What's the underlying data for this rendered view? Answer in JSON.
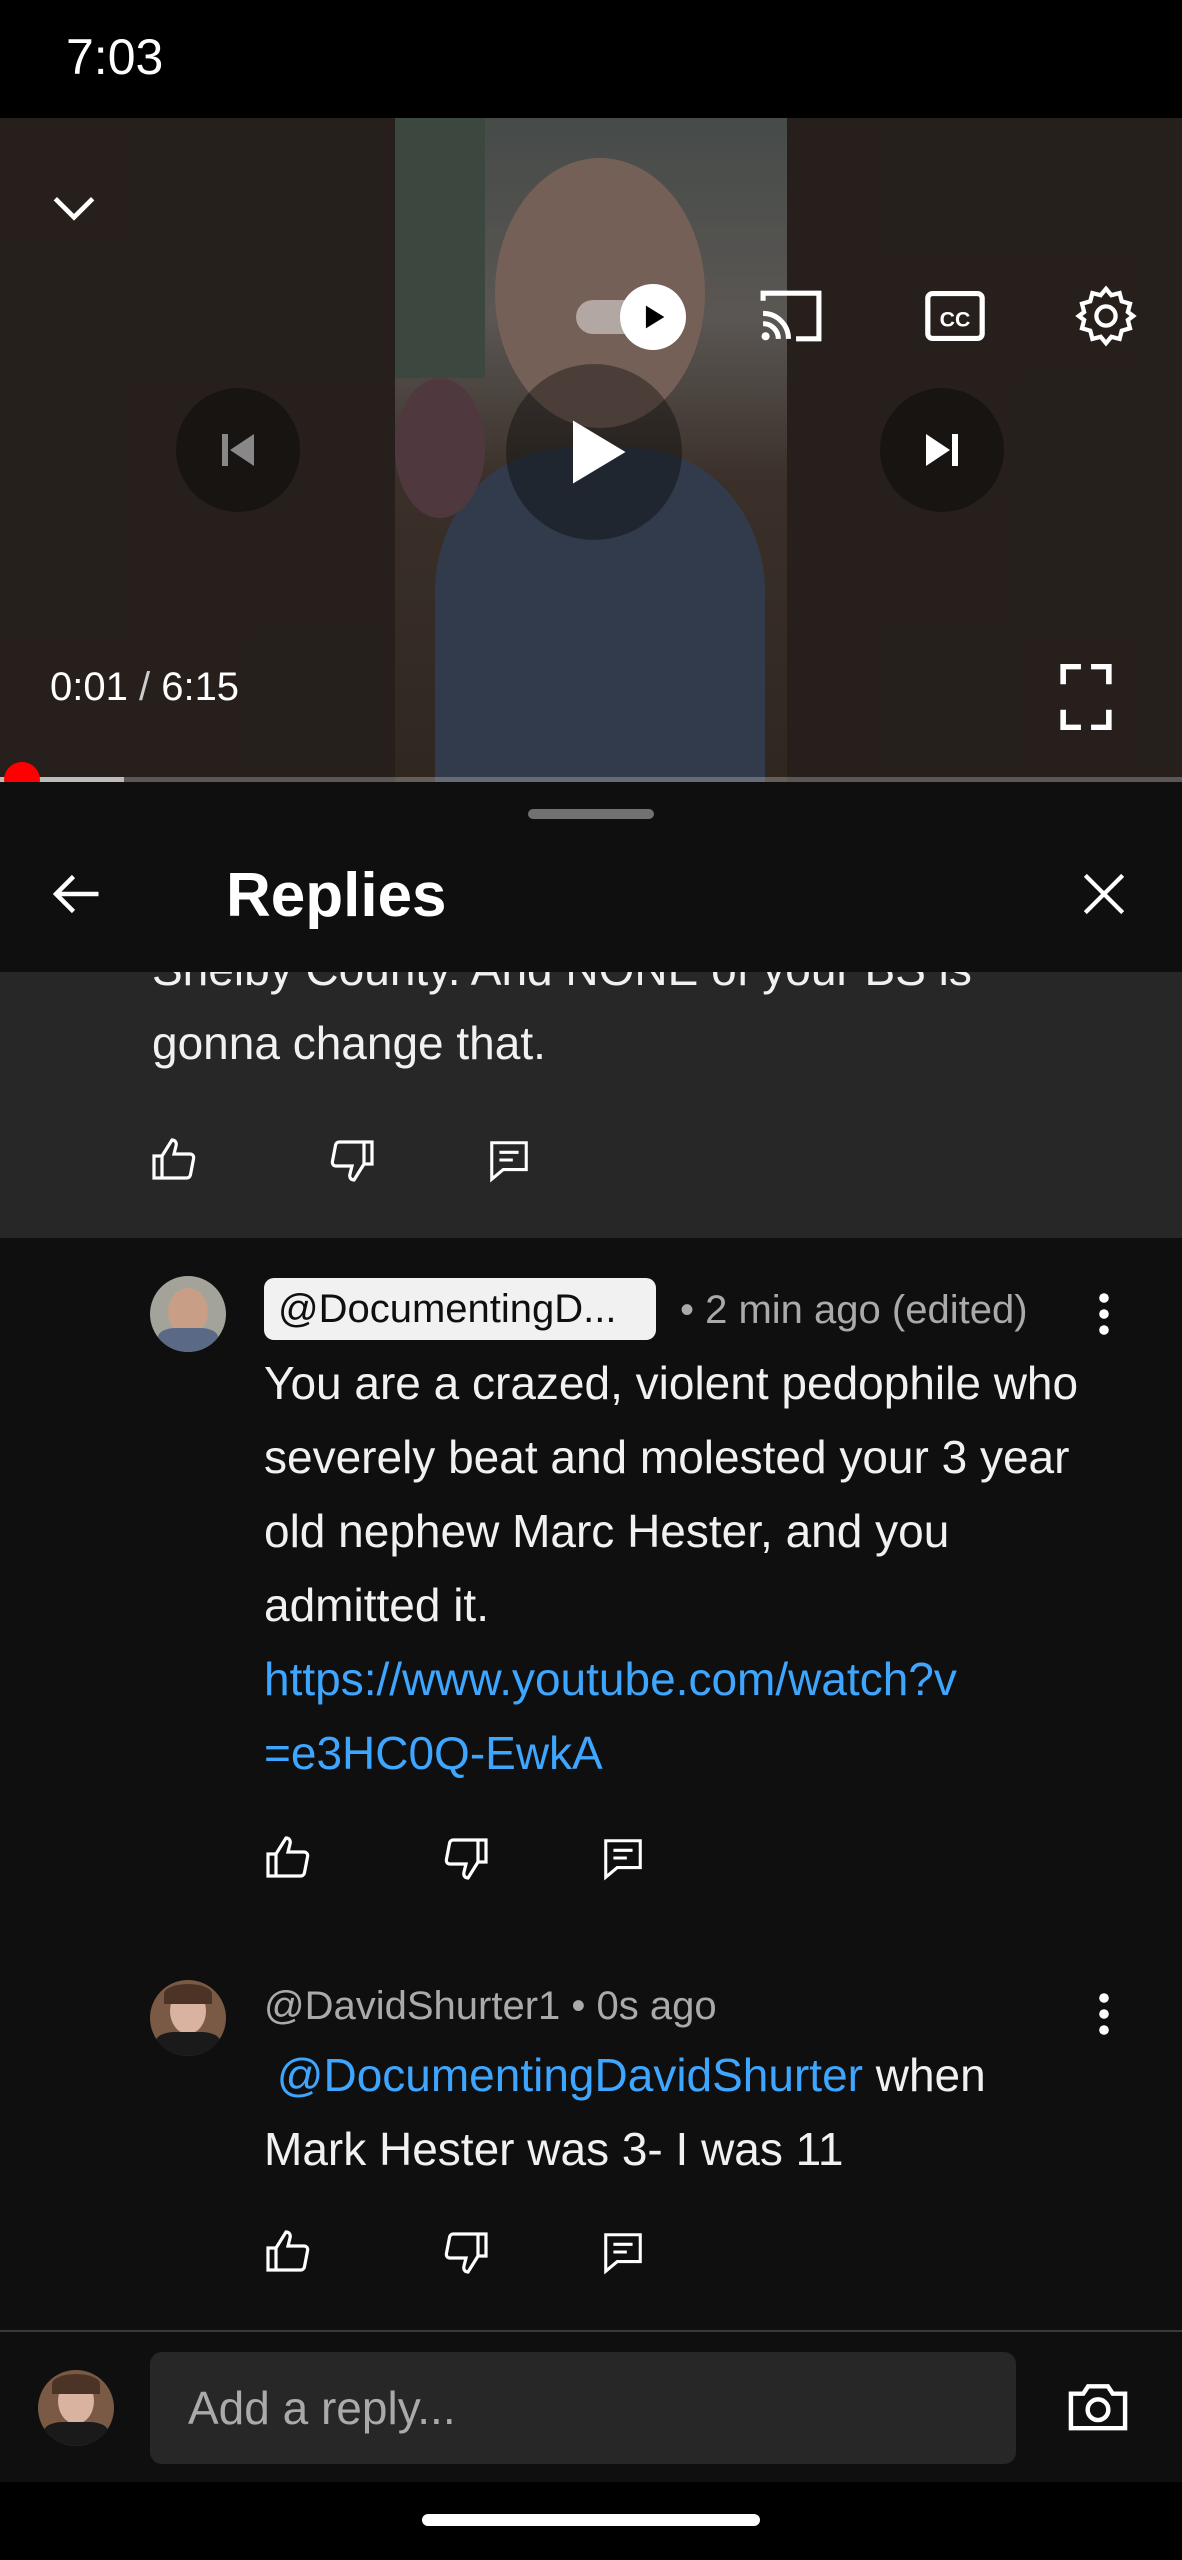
{
  "status_bar": {
    "time": "7:03"
  },
  "player": {
    "current_time": "0:01",
    "separator": " / ",
    "duration": "6:15",
    "progress_fraction": 0.003,
    "icons": [
      "chevron-down-icon",
      "autoplay-toggle-icon",
      "cast-icon",
      "captions-icon",
      "settings-gear-icon",
      "previous-icon",
      "play-icon",
      "next-icon",
      "fullscreen-icon"
    ]
  },
  "panel": {
    "title": "Replies"
  },
  "parent_comment": {
    "text_line1": "Shelby County. And NONE of your BS is",
    "text_line2": "gonna change that."
  },
  "replies": [
    {
      "handle": "@DocumentingD...",
      "meta": "• 2 min ago (edited)",
      "body": "You are a crazed, violent pedophile who severely beat and molested your 3 year old nephew Marc Hester, and you admitted it.",
      "link_line1": "https://www.youtube.com/watch?v",
      "link_line2": "=e3HC0Q-EwkA"
    },
    {
      "handle": "@DavidShurter1",
      "meta": "• 0s ago",
      "mention": "@DocumentingDavidShurter",
      "body_after_mention": " when",
      "body_line2": "Mark Hester was 3- I was 11"
    }
  ],
  "reply_bar": {
    "placeholder": "Add a reply..."
  },
  "colors": {
    "link": "#3ea6ff",
    "progress": "#ff0000",
    "background": "#0f0f0f",
    "parent_bg": "#272727"
  }
}
